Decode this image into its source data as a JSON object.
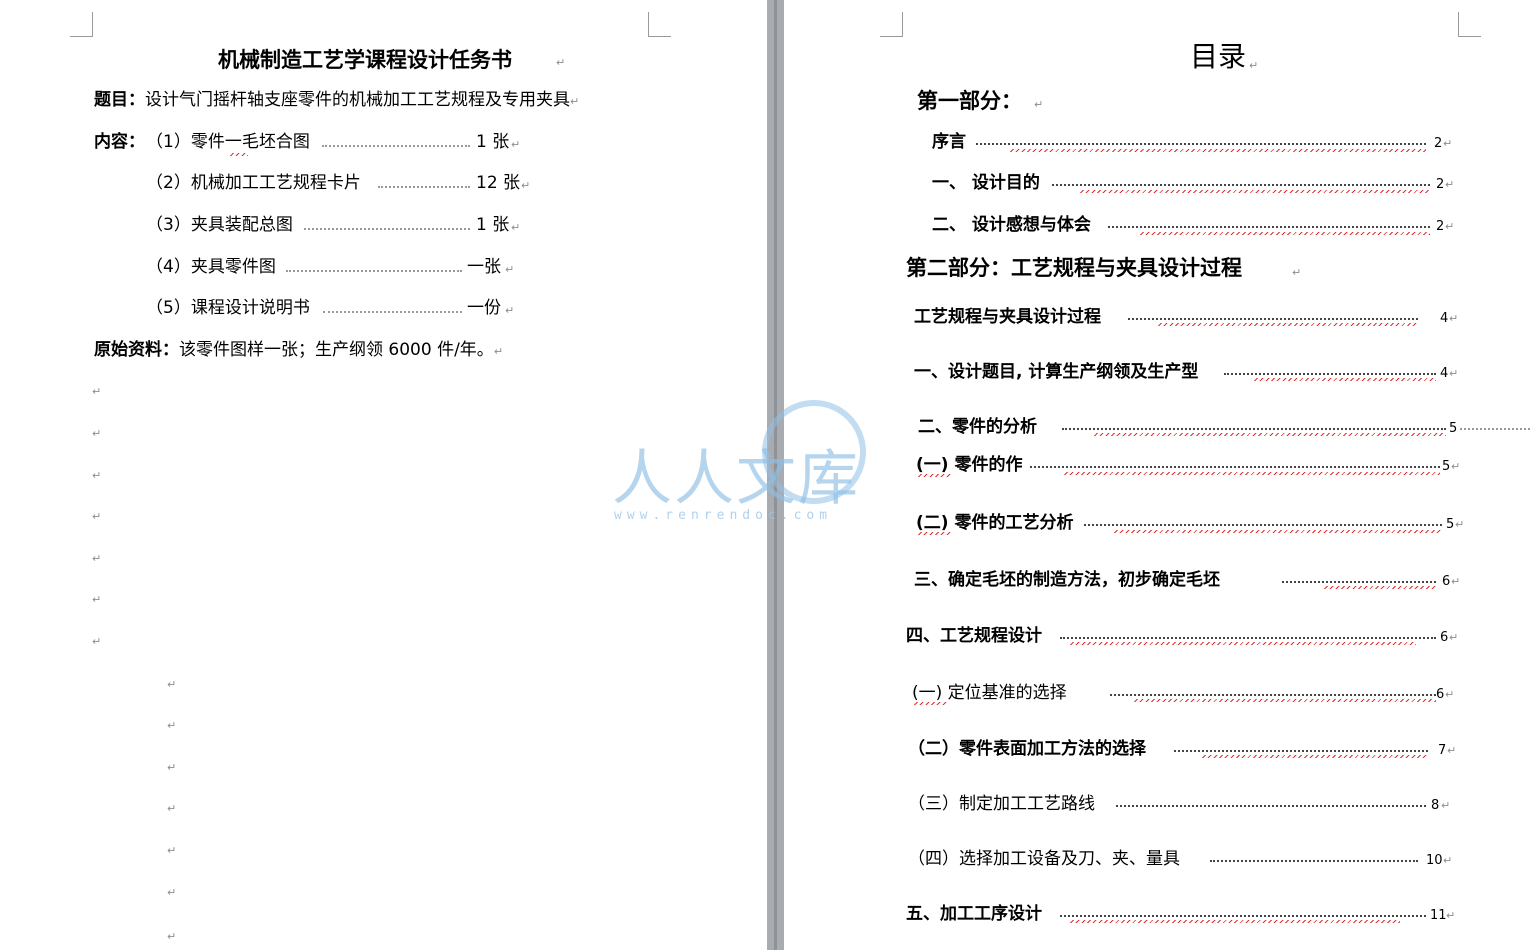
{
  "left_page": {
    "title": "机械制造工艺学课程设计任务书",
    "topic_label": "题目：",
    "topic_text": "设计气门摇杆轴支座零件的机械加工工艺规程及专用夹具",
    "content_label": "内容：",
    "items": [
      {
        "label": "（1）零件一毛坯合图",
        "qty": "1 张"
      },
      {
        "label": "（2）机械加工工艺规程卡片",
        "qty": "12 张"
      },
      {
        "label": "（3）夹具装配总图",
        "qty": "1 张"
      },
      {
        "label": "（4）夹具零件图",
        "qty": "一张"
      },
      {
        "label": "（5）课程设计说明书",
        "qty": "一份"
      }
    ],
    "source_label": "原始资料：",
    "source_text": "该零件图样一张；生产纲领 6000 件/年。"
  },
  "right_page": {
    "title": "目录",
    "part1": "第一部分：",
    "part1_entries": [
      {
        "label": "序言",
        "page": "2"
      },
      {
        "label": "一、 设计目的",
        "page": "2"
      },
      {
        "label": "二、 设计感想与体会",
        "page": "2"
      }
    ],
    "part2": "第二部分：工艺规程与夹具设计过程",
    "toc": [
      {
        "label": "工艺规程与夹具设计过程",
        "page": "4"
      },
      {
        "label": "一、设计题目, 计算生产纲领及生产型",
        "page": "4"
      },
      {
        "label": "二、零件的分析",
        "page": "5"
      },
      {
        "label": "(一) 零件的作",
        "page": "5"
      },
      {
        "label": "(二) 零件的工艺分析",
        "page": "5"
      },
      {
        "label": "三、确定毛坯的制造方法，初步确定毛坯",
        "page": "6"
      },
      {
        "label": "四、工艺规程设计",
        "page": "6"
      },
      {
        "label": "(一) 定位基准的选择",
        "page": "6"
      },
      {
        "label": "（二）零件表面加工方法的选择",
        "page": "7"
      },
      {
        "label": "（三）制定加工工艺路线",
        "page": "8"
      },
      {
        "label": "（四）选择加工设备及刀、夹、量具",
        "page": "10"
      },
      {
        "label": "五、加工工序设计",
        "page": "11"
      }
    ]
  },
  "watermark": {
    "text": "人人文库",
    "url": "www.renrendoc.com"
  },
  "colors": {
    "background": "#9a9ea4",
    "page": "#ffffff",
    "watermark": "#8fbfe6",
    "spell_underline": "#e03030"
  }
}
